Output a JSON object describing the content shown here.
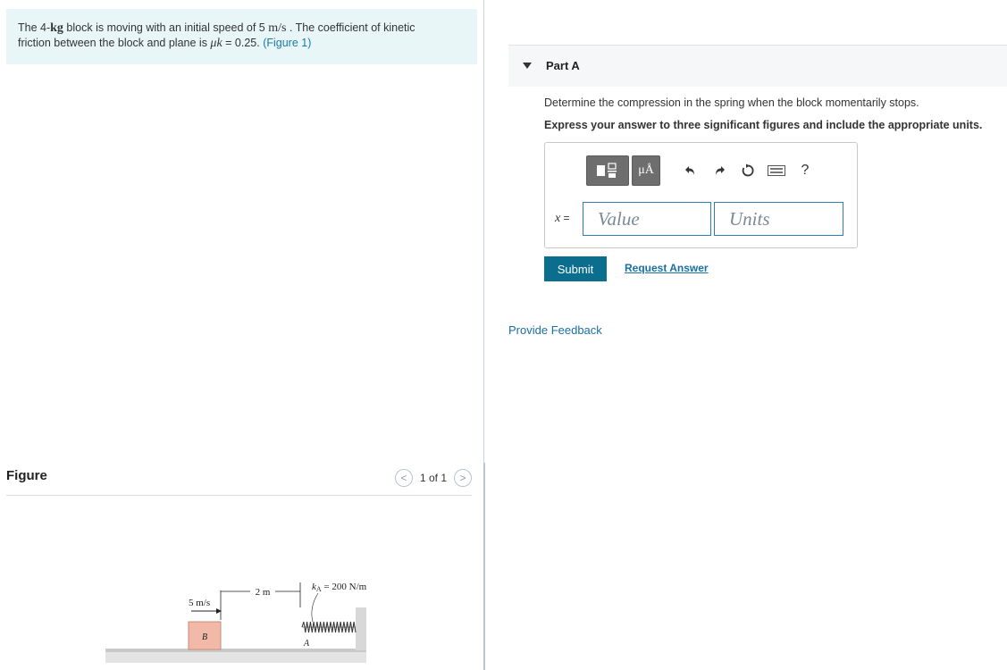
{
  "problem": {
    "p1": "The 4-",
    "mass_unit": "kg",
    "p2": " block is moving with an initial speed of 5 ",
    "speed_unit": "m/s",
    "p3": " . The coefficient of kinetic",
    "line2_a": "friction between the block and plane is ",
    "mu_symbol": "μk",
    "line2_b": " = 0.25. ",
    "figure_link": "(Figure 1)"
  },
  "figure": {
    "title": "Figure",
    "pager_text": "1 of 1",
    "prev_icon": "chevron-left-icon",
    "next_icon": "chevron-right-icon",
    "labels": {
      "speed": "5 m/s",
      "distance": "2 m",
      "spring": "kA = 200 N/m",
      "spring_k": "k",
      "spring_sub": "A",
      "spring_rest": " = 200 N/m",
      "block": "B",
      "point": "A"
    },
    "colors": {
      "block_fill": "#f2b9a8",
      "block_stroke": "#c88a78",
      "ground": "#b8b8b8"
    }
  },
  "part": {
    "title": "Part A",
    "question": "Determine the compression in the spring when the block momentarily stops.",
    "instructions": "Express your answer to three significant figures and include the appropriate units.",
    "toolbar": {
      "mu_button": "μÅ",
      "icons": [
        "templates-icon",
        "units-icon",
        "undo-icon",
        "redo-icon",
        "reset-icon",
        "keyboard-icon",
        "help-icon"
      ],
      "help_label": "?"
    },
    "variable": "x",
    "equals": " =",
    "value_placeholder": "Value",
    "units_placeholder": "Units",
    "submit_label": "Submit",
    "request_label": "Request Answer"
  },
  "feedback_label": "Provide Feedback"
}
